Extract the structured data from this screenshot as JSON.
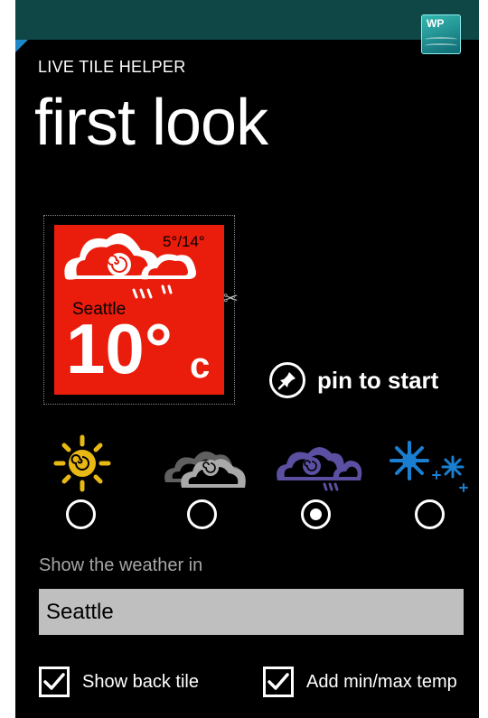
{
  "app": {
    "title": "LIVE TILE HELPER",
    "page_title": "first look"
  },
  "badge": {
    "text": "WP"
  },
  "tile": {
    "range": "5°/14°",
    "city": "Seattle",
    "temp": "10°",
    "unit": "c"
  },
  "pin": {
    "label": "pin to start"
  },
  "weather_options": [
    {
      "icon": "sun-icon",
      "selected": false
    },
    {
      "icon": "cloud-icon",
      "selected": false
    },
    {
      "icon": "cloud-rain-icon",
      "selected": true
    },
    {
      "icon": "snow-icon",
      "selected": false
    }
  ],
  "location": {
    "label": "Show the weather in",
    "value": "Seattle"
  },
  "options": {
    "back_tile_label": "Show back tile",
    "back_tile_checked": true,
    "minmax_label": "Add min/max temp",
    "minmax_checked": true
  },
  "colors": {
    "tile": "#ea1c0c",
    "sun": "#e8b814",
    "cloud": "#a9a9a9",
    "rain_cloud": "#6a5bb0",
    "snow": "#1a7fd0",
    "topbar": "#0f4747"
  }
}
